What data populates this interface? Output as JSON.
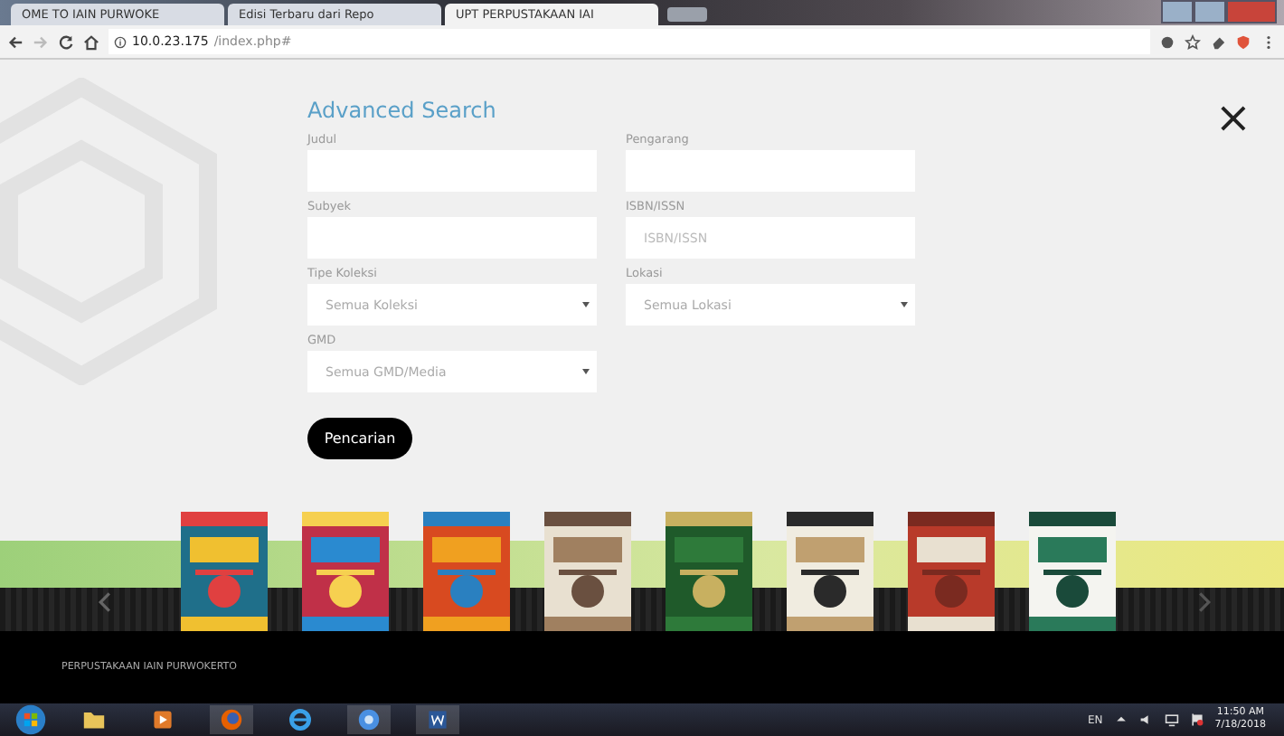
{
  "browser": {
    "tabs": [
      {
        "title": "OME TO IAIN PURWOKE",
        "selected": false
      },
      {
        "title": "Edisi Terbaru dari Repo",
        "selected": false
      },
      {
        "title": "UPT PERPUSTAKAAN IAI",
        "selected": true
      }
    ],
    "address": {
      "host": "10.0.23.175",
      "path": "/index.php#"
    }
  },
  "search": {
    "title": "Advanced Search",
    "fields": [
      {
        "label": "Judul",
        "kind": "text"
      },
      {
        "label": "Pengarang",
        "kind": "text"
      },
      {
        "label": "Subyek",
        "kind": "text"
      },
      {
        "label": "ISBN/ISSN",
        "kind": "text",
        "placeholder": "ISBN/ISSN"
      },
      {
        "label": "Tipe Koleksi",
        "kind": "select",
        "value": "Semua Koleksi"
      },
      {
        "label": "Lokasi",
        "kind": "select",
        "value": "Semua Lokasi"
      },
      {
        "label": "GMD",
        "kind": "select",
        "value": "Semua GMD/Media"
      }
    ],
    "button": "Pencarian",
    "close": "×"
  },
  "footer": "PERPUSTAKAAN IAIN PURWOKERTO",
  "taskbar": {
    "language": "EN",
    "time": "11:50 AM",
    "date": "7/18/2018"
  }
}
